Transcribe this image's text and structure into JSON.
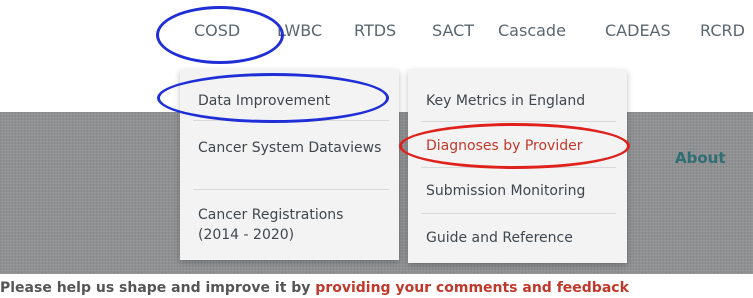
{
  "nav": {
    "items": [
      "COSD",
      "LWBC",
      "RTDS",
      "SACT",
      "Cascade",
      "CADEAS",
      "RCRD"
    ]
  },
  "menu_left": {
    "items": [
      "Data Improvement",
      "Cancer System Dataviews",
      "Cancer Registrations (2014 - 2020)"
    ]
  },
  "menu_right": {
    "items": [
      "Key Metrics in England",
      "Diagnoses by Provider",
      "Submission Monitoring",
      "Guide and Reference"
    ]
  },
  "hero": {
    "about": "About"
  },
  "footer_line": {
    "text_start": "Please help us shape and improve it by ",
    "link_text": "providing your comments and feedback"
  },
  "colors": {
    "annotation_blue": "#1f2ed6",
    "annotation_red": "#e0201b",
    "highlight_text": "#c0392b"
  }
}
